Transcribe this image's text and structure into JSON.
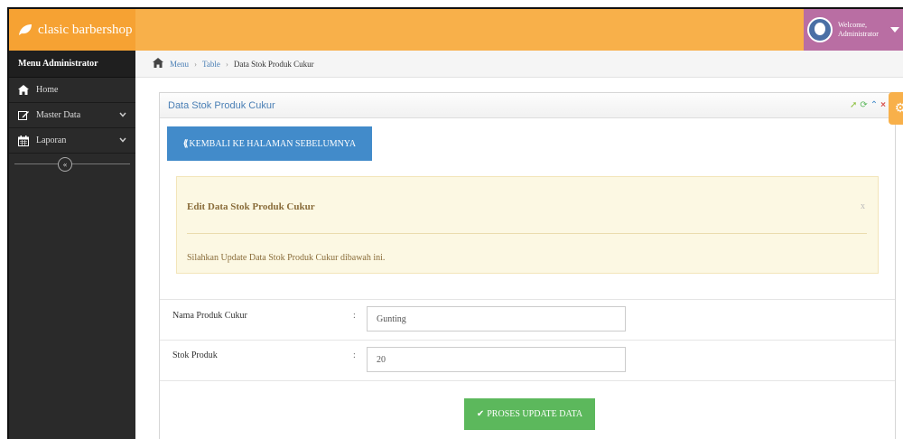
{
  "app": {
    "brand": "clasic barbershop"
  },
  "user": {
    "greeting": "Welcome,",
    "name": "Administrator"
  },
  "sidebar": {
    "header": "Menu Administrator",
    "items": [
      {
        "label": "Home",
        "icon": "home-icon"
      },
      {
        "label": "Master Data",
        "icon": "edit-icon"
      },
      {
        "label": "Laporan",
        "icon": "calendar-icon"
      }
    ],
    "collapse_glyph": "«"
  },
  "breadcrumb": {
    "items": [
      "Menu",
      "Table",
      "Data Stok Produk Cukur"
    ],
    "separator": "›"
  },
  "panel": {
    "title": "Data Stok Produk Cukur",
    "back_button": "KEMBALI KE HALAMAN SEBELUMNYA",
    "alert": {
      "title": "Edit Data Stok Produk Cukur",
      "close": "x",
      "text": "Silahkan Update Data Stok Produk Cukur dibawah ini."
    },
    "form": {
      "fields": [
        {
          "label": "Nama Produk Cukur",
          "value": "Gunting"
        },
        {
          "label": "Stok Produk",
          "value": "20"
        }
      ],
      "colon": ":",
      "submit": "PROSES UPDATE DATA"
    }
  },
  "colors": {
    "navbar": "#f8b04a",
    "sidebar": "#2a2a2a",
    "primary": "#428bca",
    "success": "#5cb85c",
    "alert_bg": "#fcf8e3",
    "user_bg": "#b96ea3"
  }
}
